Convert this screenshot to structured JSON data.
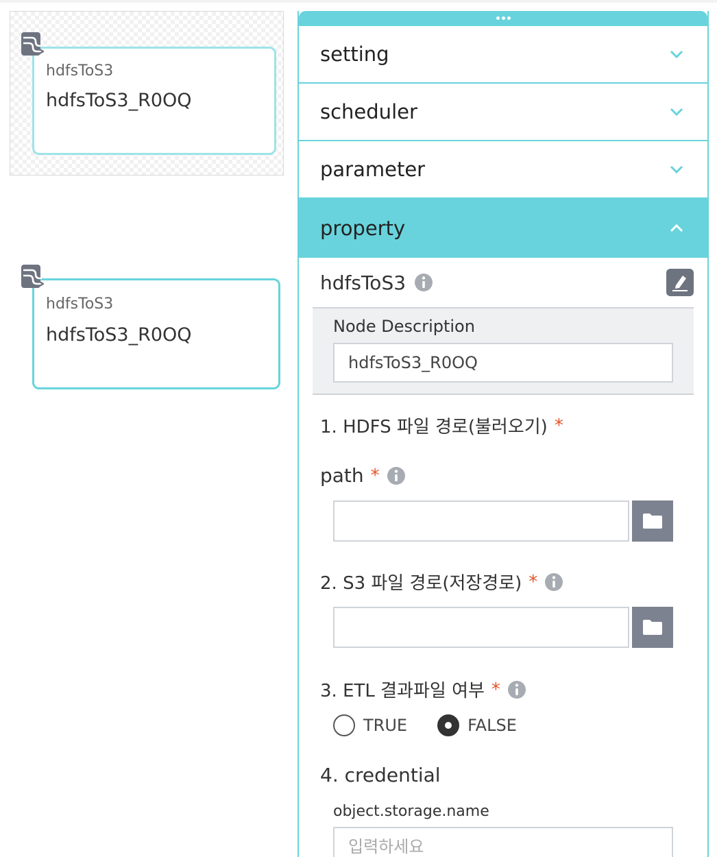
{
  "canvas": {
    "preview_node": {
      "type": "hdfsToS3",
      "name": "hdfsToS3_R0OQ"
    },
    "node": {
      "type": "hdfsToS3",
      "name": "hdfsToS3_R0OQ"
    }
  },
  "panel": {
    "sections": [
      {
        "label": "setting",
        "expanded": false
      },
      {
        "label": "scheduler",
        "expanded": false
      },
      {
        "label": "parameter",
        "expanded": false
      },
      {
        "label": "property",
        "expanded": true
      }
    ],
    "property": {
      "title": "hdfsToS3",
      "node_description_label": "Node Description",
      "node_description_value": "hdfsToS3_R0OQ",
      "section1_title": "1. HDFS 파일 경로(불러오기)",
      "path_label": "path",
      "path_value": "",
      "section2_title": "2. S3 파일 경로(저장경로)",
      "s3_path_value": "",
      "section3_title": "3. ETL 결과파일 여부",
      "radio_true": "TRUE",
      "radio_false": "FALSE",
      "radio_selected": "FALSE",
      "section4_title": "4. credential",
      "object_storage_label": "object.storage.name",
      "object_storage_placeholder": "입력하세요",
      "required_mark": "*"
    }
  },
  "colors": {
    "accent": "#68d3dc",
    "required": "#e2552b",
    "button_gray": "#7d8290"
  }
}
